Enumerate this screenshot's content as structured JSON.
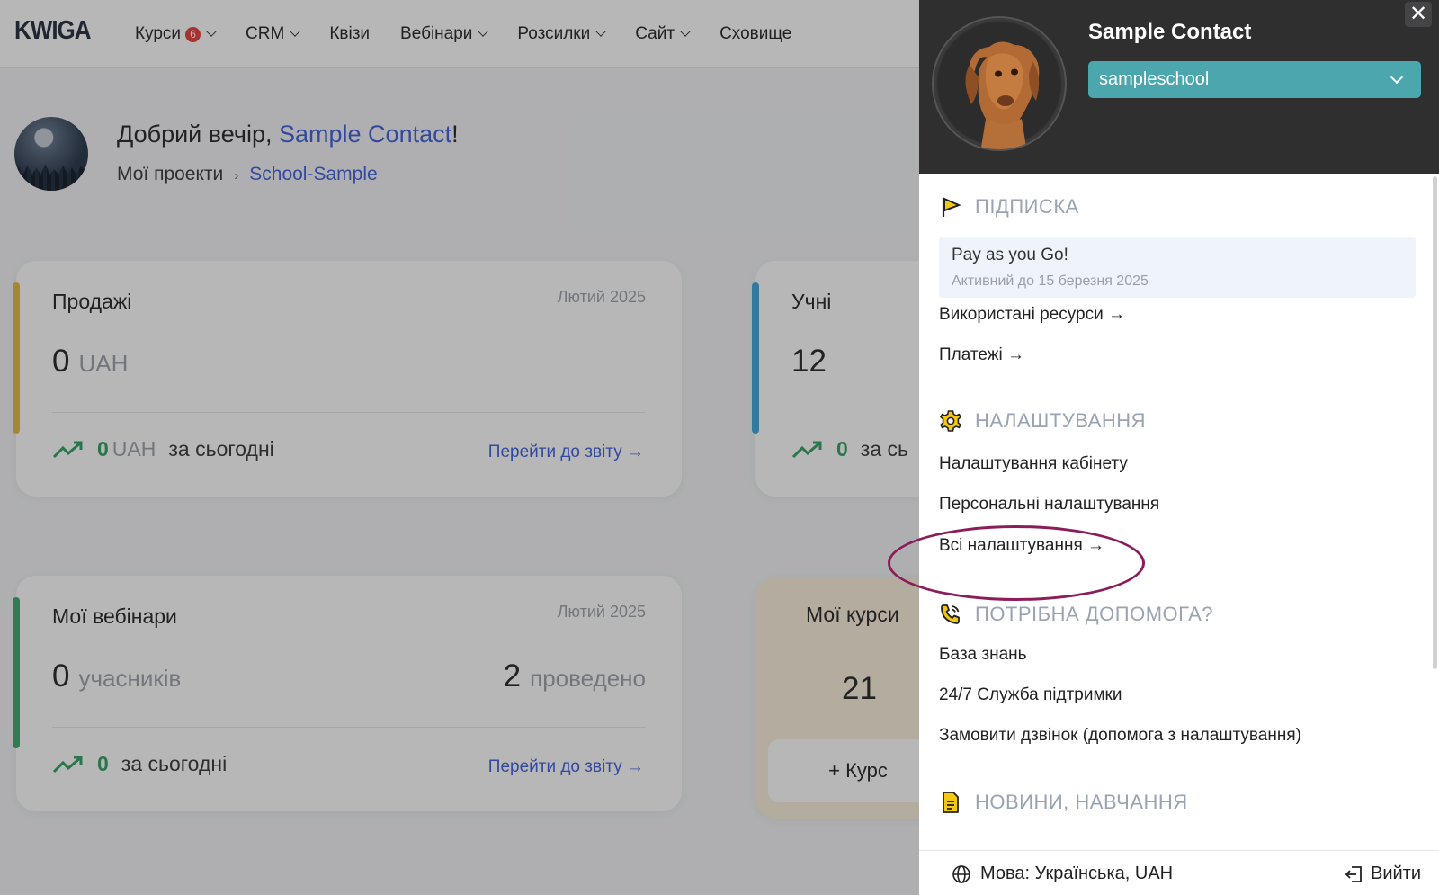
{
  "app": {
    "logo": "KWIGA",
    "nav": [
      {
        "label": "Курси",
        "badge": "6",
        "has_menu": true
      },
      {
        "label": "CRM",
        "has_menu": true
      },
      {
        "label": "Квізи",
        "has_menu": false
      },
      {
        "label": "Вебінари",
        "has_menu": true
      },
      {
        "label": "Розсилки",
        "has_menu": true
      },
      {
        "label": "Сайт",
        "has_menu": true
      },
      {
        "label": "Сховище",
        "has_menu": false
      }
    ]
  },
  "greeting": {
    "prefix": "Добрий вечір, ",
    "name": "Sample Contact",
    "suffix": "!",
    "breadcrumb_root": "Мої проекти",
    "breadcrumb_sep": "›",
    "breadcrumb_current": "School-Sample"
  },
  "cards": {
    "sales": {
      "title": "Продажі",
      "date": "Лютий 2025",
      "value": "0",
      "unit": "UAH",
      "today_value": "0",
      "today_unit": "UAH",
      "today_label": "за сьогодні",
      "report_link": "Перейти до звіту →",
      "accent": "#e5b73b"
    },
    "students": {
      "title": "Учні",
      "value": "12",
      "today_value": "0",
      "today_label": "за сь",
      "accent": "#3aa3db"
    },
    "webinars": {
      "title": "Мої вебінари",
      "date": "Лютий 2025",
      "value": "0",
      "unit": "учасників",
      "held_value": "2",
      "held_unit": "проведено",
      "today_value": "0",
      "today_label": "за сьогодні",
      "report_link": "Перейти до звіту →",
      "accent": "#39a86b"
    },
    "courses": {
      "title": "Мої курси",
      "value": "21",
      "add_button": "+ Курс"
    }
  },
  "panel": {
    "close_label": "✕",
    "name": "Sample Contact",
    "school": "sampleschool",
    "subscription": {
      "heading": "ПІДПИСКА",
      "plan": "Pay as you Go!",
      "active_until": "Активний до 15 березня 2025",
      "links": [
        "Використані ресурси →",
        "Платежі →"
      ]
    },
    "settings": {
      "heading": "НАЛАШТУВАННЯ",
      "links": [
        "Налаштування кабінету",
        "Персональні налаштування",
        "Всі налаштування →"
      ]
    },
    "help": {
      "heading": "ПОТРІБНА ДОПОМОГА?",
      "links": [
        "База знань",
        "24/7 Служба підтримки",
        "Замовити дзвінок (допомога з налаштування)"
      ]
    },
    "news": {
      "heading": "НОВИНИ, НАВЧАННЯ"
    },
    "footer": {
      "language": "Мова: Українська, UAH",
      "logout": "Вийти"
    }
  },
  "colors": {
    "brand_blue": "#3b5bdb",
    "teal": "#4ba6ad",
    "positive": "#2e9e5e",
    "highlight": "#8b1e5a",
    "icon_yellow": "#f2c811"
  }
}
